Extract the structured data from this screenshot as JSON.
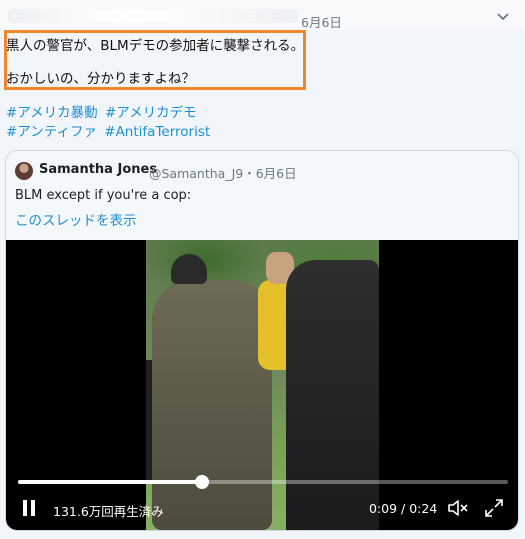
{
  "tweet": {
    "date": "6月6日",
    "text_line1": "黒人の警官が、BLMデモの参加者に襲撃される。",
    "text_line2": "おかしいの、分かりますよね？",
    "hashtags": [
      "#アメリカ暴動",
      "#アメリカデモ",
      "#アンティファ",
      "#AntifaTerrorist"
    ]
  },
  "quoted": {
    "name": "Samantha Jones",
    "handle_date": "@Samantha_J9・6月6日",
    "text": "BLM except if you're a cop:",
    "thread_link": "このスレッドを表示"
  },
  "video": {
    "progress_fraction": 0.375,
    "views": "131.6万回再生済み",
    "time": "0:09 / 0:24"
  },
  "colors": {
    "link": "#1d8fd6",
    "highlight_border": "#f0882b"
  },
  "icons": [
    "more-chevron-icon",
    "pause-icon",
    "mute-icon",
    "fullscreen-icon"
  ]
}
